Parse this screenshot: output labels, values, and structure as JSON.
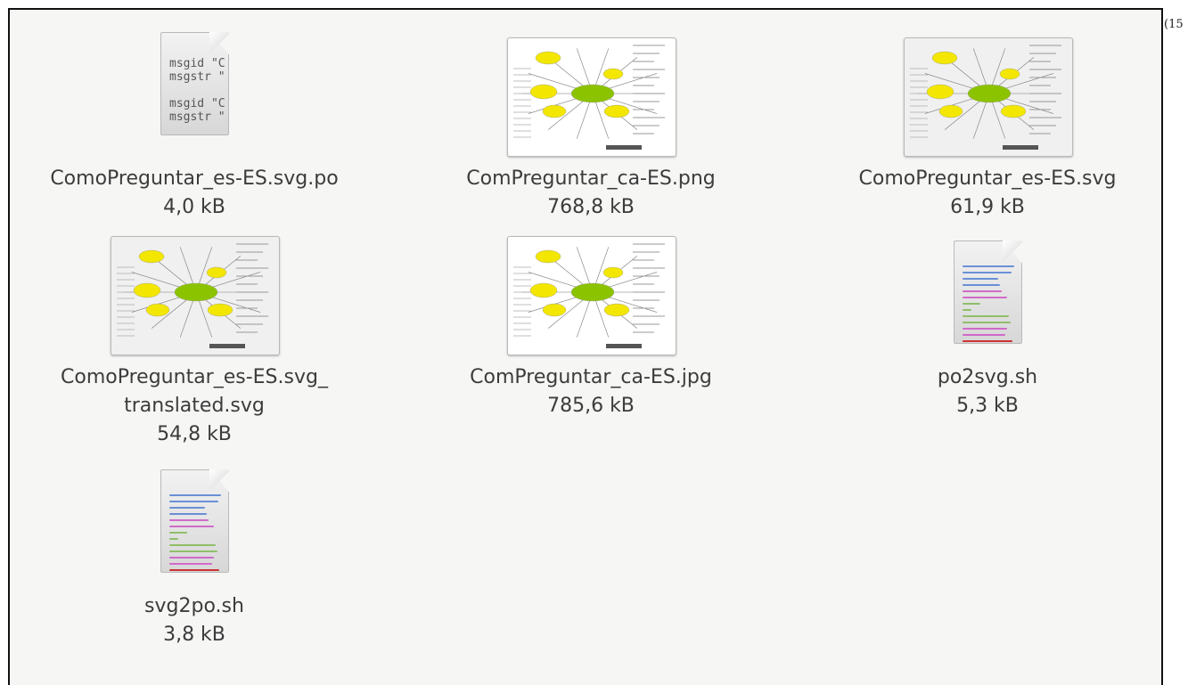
{
  "side_note": "(15",
  "files": [
    {
      "name": "ComoPreguntar_es-ES.svg.po",
      "size": "4,0 kB",
      "icon": "po-document-icon",
      "po_preview": "msgid \"C\nmsgstr \"\n\nmsgid \"C\nmsgstr \""
    },
    {
      "name": "ComPreguntar_ca-ES.png",
      "size": "768,8 kB",
      "icon": "mindmap-thumbnail"
    },
    {
      "name": "ComoPreguntar_es-ES.svg",
      "size": "61,9 kB",
      "icon": "mindmap-thumbnail"
    },
    {
      "name": "ComoPreguntar_es-ES.svg_",
      "name2": "translated.svg",
      "size": "54,8 kB",
      "icon": "mindmap-thumbnail"
    },
    {
      "name": "ComPreguntar_ca-ES.jpg",
      "size": "785,6 kB",
      "icon": "mindmap-thumbnail"
    },
    {
      "name": "po2svg.sh",
      "size": "5,3 kB",
      "icon": "shell-script-icon"
    },
    {
      "name": "svg2po.sh",
      "size": "3,8 kB",
      "icon": "shell-script-icon"
    }
  ],
  "colors": {
    "background": "#f6f6f5",
    "text": "#3c3c3c",
    "node_yellow": "#f3e600",
    "node_green": "#8cc300"
  }
}
